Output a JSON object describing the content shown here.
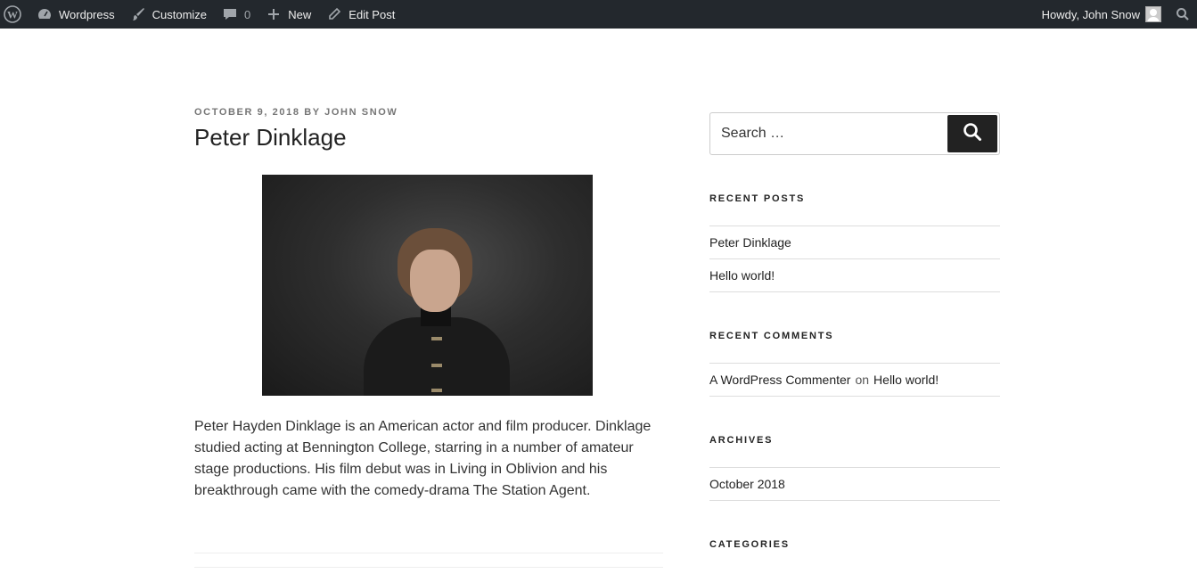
{
  "adminbar": {
    "site_name": "Wordpress",
    "customize": "Customize",
    "comments_count": "0",
    "new": "New",
    "edit_post": "Edit Post",
    "howdy": "Howdy, John Snow"
  },
  "post": {
    "date": "OCTOBER 9, 2018",
    "by": "BY",
    "author": "JOHN SNOW",
    "title": "Peter Dinklage",
    "body": "Peter Hayden Dinklage is an American actor and film producer. Dinklage studied acting at Bennington College, starring in a number of amateur stage productions. His film debut was in Living in Oblivion and his breakthrough came with the comedy-drama The Station Agent."
  },
  "sidebar": {
    "search_placeholder": "Search …",
    "recent_posts": {
      "title": "RECENT POSTS",
      "items": [
        "Peter Dinklage",
        "Hello world!"
      ]
    },
    "recent_comments": {
      "title": "RECENT COMMENTS",
      "author": "A WordPress Commenter",
      "on": "on",
      "post": "Hello world!"
    },
    "archives": {
      "title": "ARCHIVES",
      "items": [
        "October 2018"
      ]
    },
    "categories": {
      "title": "CATEGORIES"
    }
  }
}
